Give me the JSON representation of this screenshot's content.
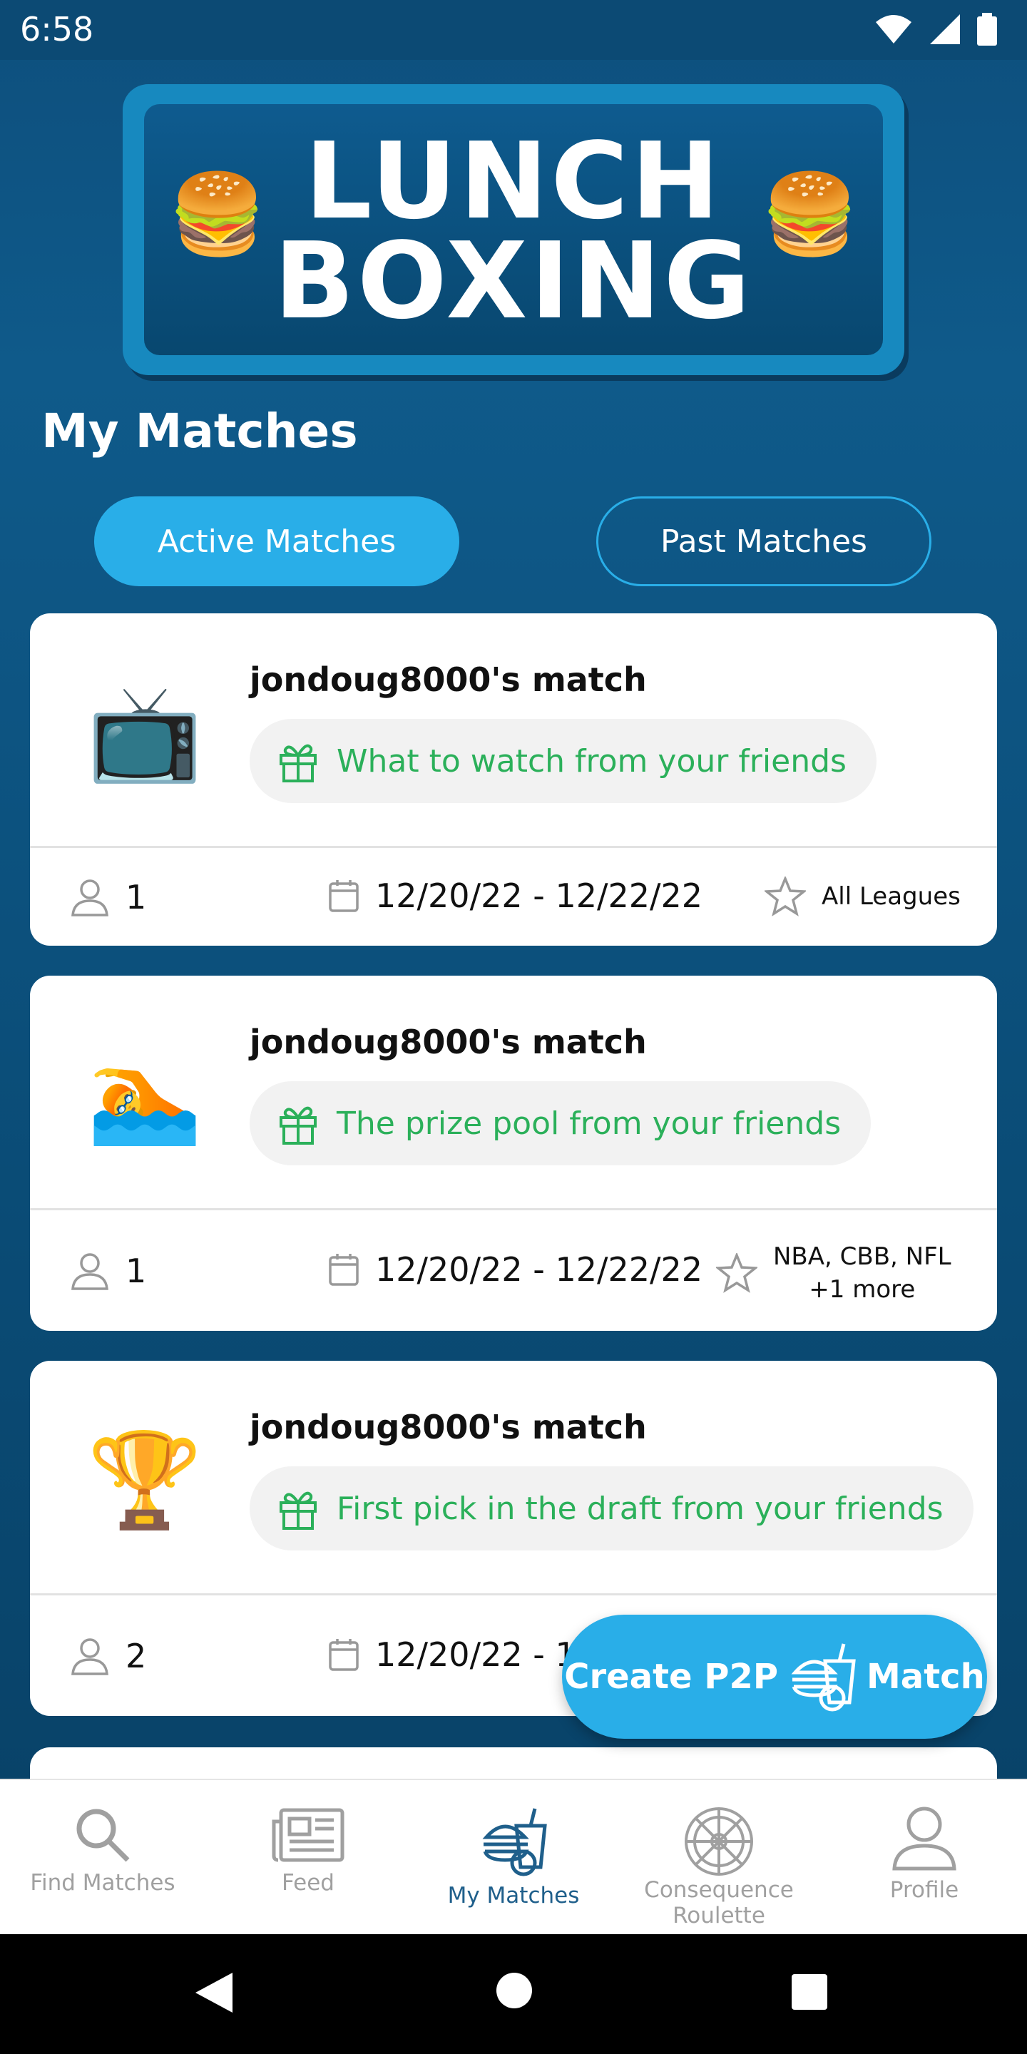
{
  "status_bar": {
    "time": "6:58"
  },
  "logo": {
    "line1": "LUNCH",
    "line2": "BOXING"
  },
  "page_title": "My Matches",
  "tabs": {
    "active": "Active Matches",
    "past": "Past Matches"
  },
  "matches": [
    {
      "title": "jondoug8000's match",
      "icon": "tv-icon",
      "emoji": "📺",
      "prize": "What to watch from your friends",
      "participants": "1",
      "dates": "12/20/22 - 12/22/22",
      "leagues": "All Leagues",
      "leagues_more": ""
    },
    {
      "title": "jondoug8000's match",
      "icon": "pool-icon",
      "emoji": "🏊",
      "prize": "The prize pool from your friends",
      "participants": "1",
      "dates": "12/20/22 - 12/22/22",
      "leagues": "NBA, CBB, NFL",
      "leagues_more": "+1 more"
    },
    {
      "title": "jondoug8000's match",
      "icon": "trophy-icon",
      "emoji": "🏆",
      "prize": "First pick in the draft from your friends",
      "participants": "2",
      "dates": "12/20/22 - 12/22/22",
      "leagues": "",
      "leagues_more": ""
    }
  ],
  "fab": {
    "label_left": "Create P2P",
    "label_right": "Match"
  },
  "bottom_nav": [
    {
      "label": "Find Matches",
      "icon": "search-icon"
    },
    {
      "label": "Feed",
      "icon": "newspaper-icon"
    },
    {
      "label": "My Matches",
      "icon": "lunch-box-icon",
      "active": true
    },
    {
      "label": "Consequence Roulette",
      "icon": "roulette-wheel-icon"
    },
    {
      "label": "Profile",
      "icon": "person-icon"
    }
  ],
  "colors": {
    "accent": "#29aee8",
    "prize_green": "#2bb05a",
    "nav_active": "#1f5f8b",
    "background": "#0d4f7d"
  }
}
